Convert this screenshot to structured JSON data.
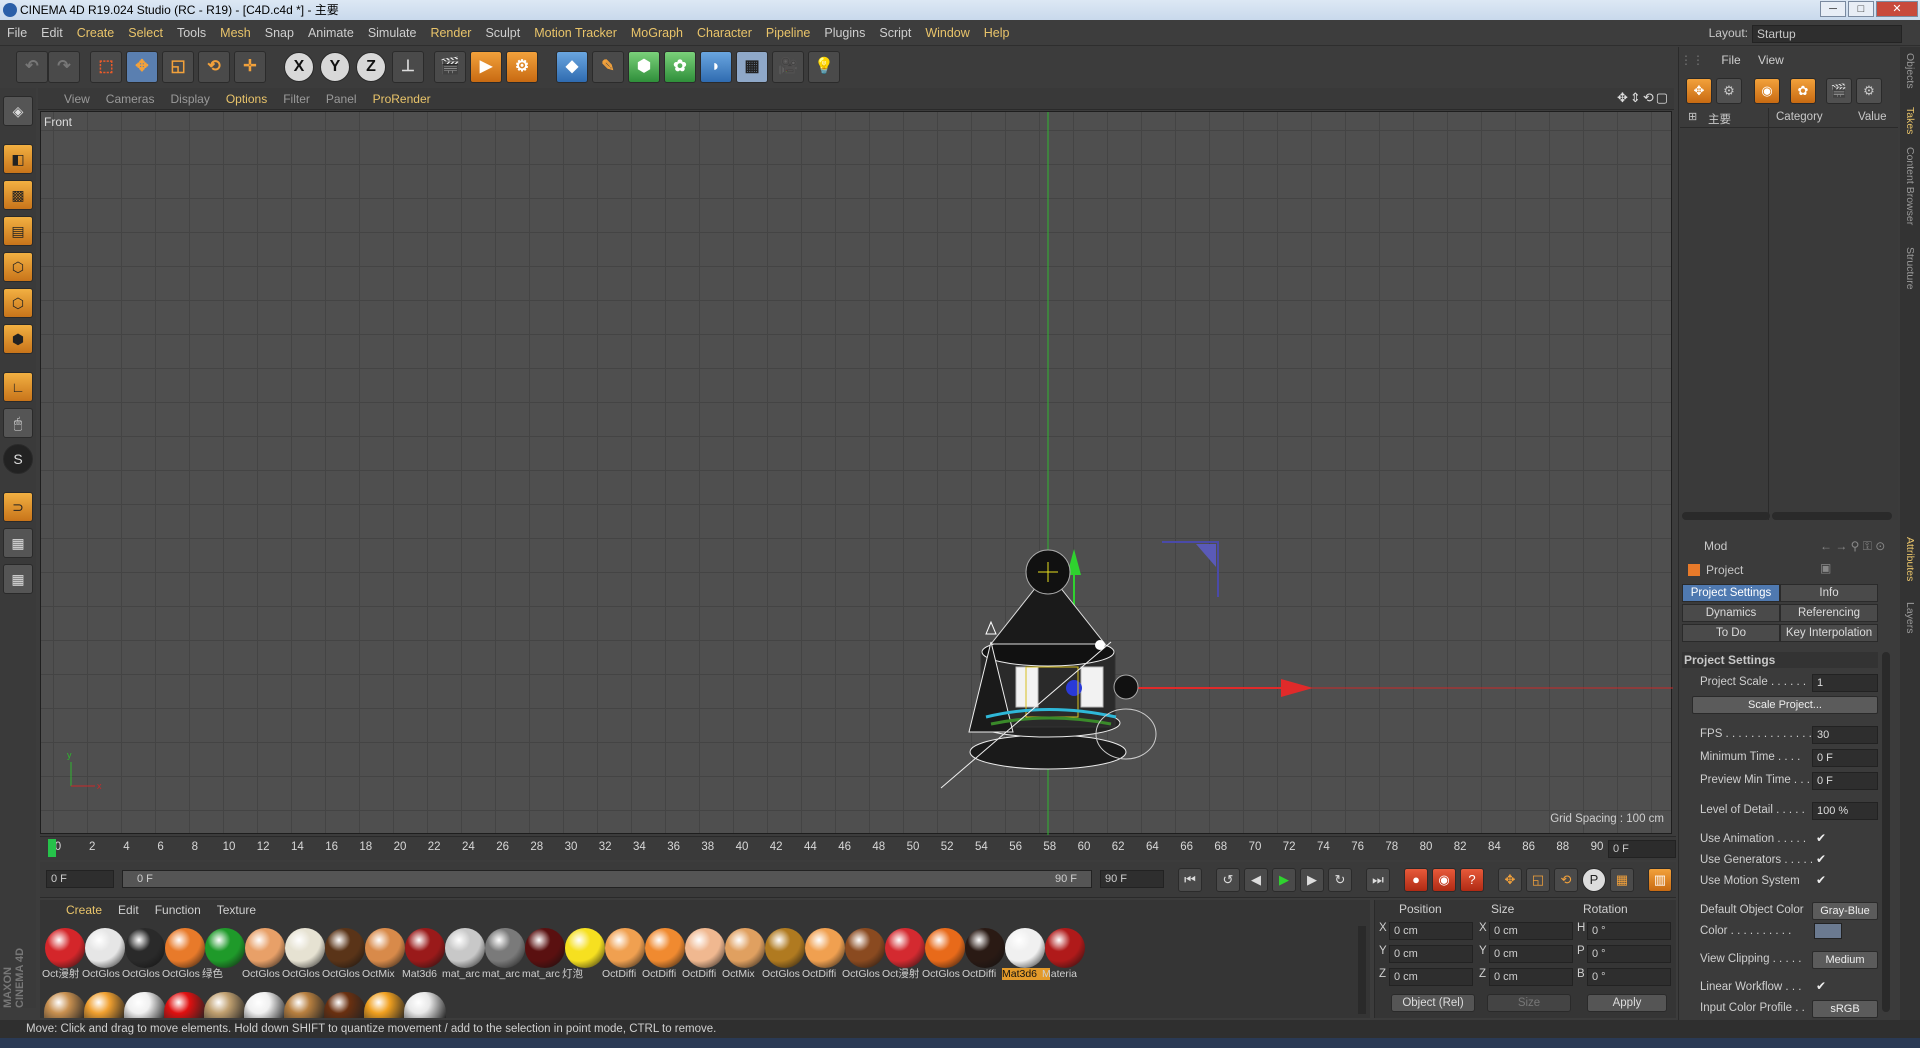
{
  "window": {
    "title": "CINEMA 4D R19.024 Studio (RC - R19) - [C4D.c4d *] - 主要",
    "min": "─",
    "max": "□",
    "close": "✕"
  },
  "menubar": {
    "items": [
      "File",
      "Edit",
      "Create",
      "Select",
      "Tools",
      "Mesh",
      "Snap",
      "Animate",
      "Simulate",
      "Render",
      "Sculpt",
      "Motion Tracker",
      "MoGraph",
      "Character",
      "Pipeline",
      "Plugins",
      "Script",
      "Window",
      "Help"
    ],
    "layout_label": "Layout:",
    "layout_value": "Startup"
  },
  "viewport": {
    "menu": [
      "View",
      "Cameras",
      "Display",
      "Options",
      "Filter",
      "Panel",
      "ProRender"
    ],
    "label": "Front",
    "grid_spacing": "Grid Spacing : 100 cm"
  },
  "timeline": {
    "ticks": [
      "0",
      "2",
      "4",
      "6",
      "8",
      "10",
      "12",
      "14",
      "16",
      "18",
      "20",
      "22",
      "24",
      "26",
      "28",
      "30",
      "32",
      "34",
      "36",
      "38",
      "40",
      "42",
      "44",
      "46",
      "48",
      "50",
      "52",
      "54",
      "56",
      "58",
      "60",
      "62",
      "64",
      "66",
      "68",
      "70",
      "72",
      "74",
      "76",
      "78",
      "80",
      "82",
      "84",
      "86",
      "88",
      "90"
    ],
    "current_frame": "0 F",
    "start": "0 F",
    "range_start": "0 F",
    "range_end": "90 F",
    "end": "90 F"
  },
  "materials": {
    "menu": [
      "Create",
      "Edit",
      "Function",
      "Texture"
    ],
    "items": [
      {
        "label": "Oct漫射",
        "color": "#d4262a",
        "icon": "snowflake-icon"
      },
      {
        "label": "OctGlos",
        "color": "#e6e6e6"
      },
      {
        "label": "OctGlos",
        "color": "#2a2a2a"
      },
      {
        "label": "OctGlos",
        "color": "#e87a2a"
      },
      {
        "label": "绿色",
        "color": "#1f9a2a"
      },
      {
        "label": "OctGlos",
        "color": "#e8a068"
      },
      {
        "label": "OctGlos",
        "color": "#e6e2d2"
      },
      {
        "label": "OctGlos",
        "color": "#5a3418"
      },
      {
        "label": "OctMix",
        "color": "#d88a4a",
        "icon": "mix-icon"
      },
      {
        "label": "Mat3d6",
        "color": "#9a1a1a"
      },
      {
        "label": "mat_arc",
        "color": "#c8c8c8"
      },
      {
        "label": "mat_arc",
        "color": "#7a7a7a"
      },
      {
        "label": "mat_arc",
        "color": "#5a1010"
      },
      {
        "label": "灯泡",
        "color": "#f6e020"
      },
      {
        "label": "OctDiffi",
        "color": "#f0a050"
      },
      {
        "label": "OctDiffi",
        "color": "#f08a30"
      },
      {
        "label": "OctDiffi",
        "color": "#f0b890"
      },
      {
        "label": "OctMix",
        "color": "#e0a060",
        "icon": "mix-icon"
      },
      {
        "label": "OctGlos",
        "color": "#b07a20"
      },
      {
        "label": "OctDiffi",
        "color": "#f0a050"
      },
      {
        "label": "OctGlos",
        "color": "#8a4a20"
      },
      {
        "label": "Oct漫射",
        "color": "#d42a30"
      },
      {
        "label": "OctGlos",
        "color": "#e86a1a"
      },
      {
        "label": "OctDiffi",
        "color": "#2a1a14"
      },
      {
        "label": "Mat3d6",
        "color": "#f0f0f0",
        "selected": true
      },
      {
        "label": "Materia",
        "color": "#b01a1a",
        "icon": "snowflake-icon"
      }
    ],
    "row2_colors": [
      "#c89050",
      "#f0a030",
      "#f0f0f0",
      "#e01010",
      "#c0a070",
      "#f0f0f0",
      "#b88040",
      "#6a3010",
      "#f0a020",
      "#e8e8e8"
    ]
  },
  "coords": {
    "headers": [
      "Position",
      "Size",
      "Rotation"
    ],
    "rows": [
      {
        "axis": "X",
        "pos": "0 cm",
        "saxis": "X",
        "size": "0 cm",
        "raxis": "H",
        "rot": "0 °"
      },
      {
        "axis": "Y",
        "pos": "0 cm",
        "saxis": "Y",
        "size": "0 cm",
        "raxis": "P",
        "rot": "0 °"
      },
      {
        "axis": "Z",
        "pos": "0 cm",
        "saxis": "Z",
        "size": "0 cm",
        "raxis": "B",
        "rot": "0 °"
      }
    ],
    "mode": "Object (Rel)",
    "size_mode": "Size",
    "apply": "Apply"
  },
  "status": "Move: Click and drag to move elements. Hold down SHIFT to quantize movement / add to the selection in point mode, CTRL to remove.",
  "objects": {
    "menu": [
      "File",
      "View"
    ],
    "tree_item": "主要",
    "col_category": "Category",
    "col_value": "Value"
  },
  "attributes": {
    "mode": "Mod",
    "title": "Project",
    "tabs": [
      "Project Settings",
      "Info",
      "Dynamics",
      "Referencing",
      "To Do",
      "Key Interpolation"
    ],
    "section": "Project Settings",
    "rows": [
      {
        "label": "Project Scale . . . . . .",
        "value": "1"
      },
      {
        "label": "FPS . . . . . . . . . . . . . .",
        "value": "30"
      },
      {
        "label": "Minimum Time . . . .",
        "value": "0 F"
      },
      {
        "label": "Preview Min Time . . .",
        "value": "0 F"
      },
      {
        "label": "Level of Detail . . . . .",
        "value": "100 %"
      }
    ],
    "scale_button": "Scale Project...",
    "checks": [
      "Use Animation . . . . .",
      "Use Generators . . . . .",
      "Use Motion System"
    ],
    "default_color_label": "Default Object Color",
    "default_color_value": "Gray-Blue",
    "color_label": "Color . . . . . . . . . .",
    "view_clipping_label": "View Clipping . . . . .",
    "view_clipping_value": "Medium",
    "linear_workflow": "Linear Workflow . . .",
    "input_profile_label": "Input Color Profile . .",
    "input_profile_value": "sRGB"
  },
  "side_tabs": [
    "Objects",
    "Takes",
    "Content Browser",
    "Structure",
    "Attributes",
    "Layers"
  ]
}
